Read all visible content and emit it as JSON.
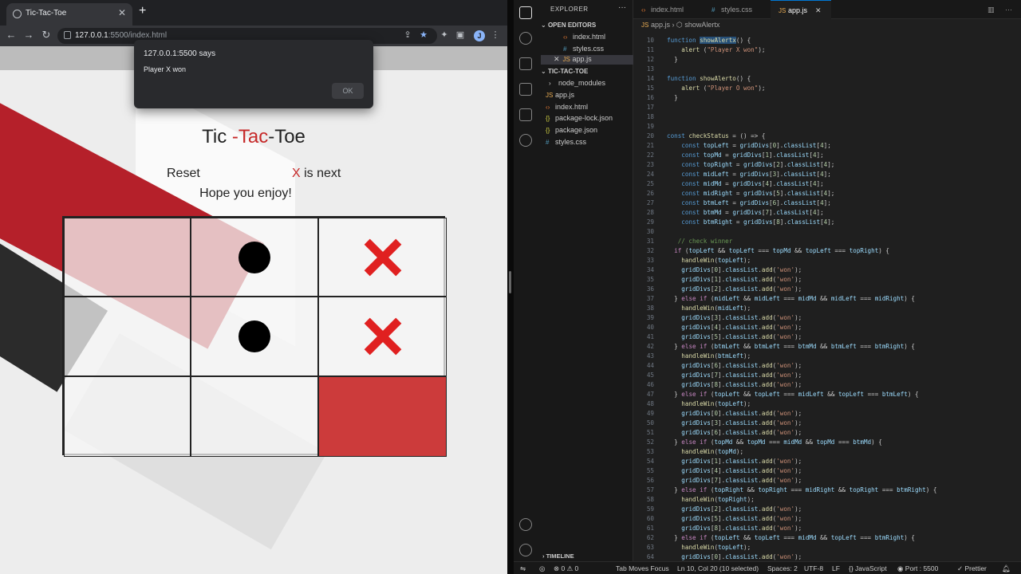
{
  "browser": {
    "tab_title": "Tic-Tac-Toe",
    "url_host": "127.0.0.1",
    "url_rest": ":5500/index.html",
    "profile_initial": "J"
  },
  "alert": {
    "origin": "127.0.0.1:5500 says",
    "message": "Player X won",
    "ok_label": "OK"
  },
  "game": {
    "title_part1": "Tic ",
    "title_part2": "-Tac",
    "title_part3": "-Toe",
    "reset_label": "Reset",
    "status_mark": "X",
    "status_text": " is next",
    "greeting": "Hope you enjoy!",
    "cells": [
      "",
      "o",
      "x",
      "",
      "o",
      "x",
      "",
      "",
      "won"
    ]
  },
  "vscode": {
    "explorer_title": "EXPLORER",
    "open_editors": "OPEN EDITORS",
    "open_files": [
      "index.html",
      "styles.css",
      "app.js"
    ],
    "project": "TIC-TAC-TOE",
    "project_files": [
      "node_modules",
      "app.js",
      "index.html",
      "package-lock.json",
      "package.json",
      "styles.css"
    ],
    "tabs": [
      "index.html",
      "styles.css",
      "app.js"
    ],
    "breadcrumb_file": "app.js",
    "breadcrumb_symbol": "showAlertx",
    "timeline": "TIMELINE",
    "status": {
      "problems": "⊗ 0 ⚠ 0",
      "tab_moves": "Tab Moves Focus",
      "position": "Ln 10, Col 20 (10 selected)",
      "spaces": "Spaces: 2",
      "encoding": "UTF-8",
      "eol": "LF",
      "language": "{} JavaScript",
      "port": "◉ Port : 5500",
      "prettier": "✓ Prettier"
    }
  },
  "code_lines": [
    {
      "n": "10",
      "t": "function showAlertx() {"
    },
    {
      "n": "11",
      "t": "    alert (\"Player X won\");"
    },
    {
      "n": "12",
      "t": "  }"
    },
    {
      "n": "13",
      "t": ""
    },
    {
      "n": "14",
      "t": "function showAlerto() {"
    },
    {
      "n": "15",
      "t": "    alert (\"Player O won\");"
    },
    {
      "n": "16",
      "t": "  }"
    },
    {
      "n": "17",
      "t": ""
    },
    {
      "n": "18",
      "t": ""
    },
    {
      "n": "19",
      "t": ""
    },
    {
      "n": "20",
      "t": "const checkStatus = () => {"
    },
    {
      "n": "21",
      "t": "    const topLeft = gridDivs[0].classList[4];"
    },
    {
      "n": "22",
      "t": "    const topMd = gridDivs[1].classList[4];"
    },
    {
      "n": "23",
      "t": "    const topRight = gridDivs[2].classList[4];"
    },
    {
      "n": "24",
      "t": "    const midLeft = gridDivs[3].classList[4];"
    },
    {
      "n": "25",
      "t": "    const midMd = gridDivs[4].classList[4];"
    },
    {
      "n": "26",
      "t": "    const midRight = gridDivs[5].classList[4];"
    },
    {
      "n": "27",
      "t": "    const btmLeft = gridDivs[6].classList[4];"
    },
    {
      "n": "28",
      "t": "    const btmMd = gridDivs[7].classList[4];"
    },
    {
      "n": "29",
      "t": "    const btmRight = gridDivs[8].classList[4];"
    },
    {
      "n": "30",
      "t": ""
    },
    {
      "n": "31",
      "t": "   // check winner"
    },
    {
      "n": "32",
      "t": "  if (topLeft && topLeft === topMd && topLeft === topRight) {"
    },
    {
      "n": "33",
      "t": "    handleWin(topLeft);"
    },
    {
      "n": "34",
      "t": "    gridDivs[0].classList.add('won');"
    },
    {
      "n": "35",
      "t": "    gridDivs[1].classList.add('won');"
    },
    {
      "n": "36",
      "t": "    gridDivs[2].classList.add('won');"
    },
    {
      "n": "37",
      "t": "  } else if (midLeft && midLeft === midMd && midLeft === midRight) {"
    },
    {
      "n": "38",
      "t": "    handleWin(midLeft);"
    },
    {
      "n": "39",
      "t": "    gridDivs[3].classList.add('won');"
    },
    {
      "n": "40",
      "t": "    gridDivs[4].classList.add('won');"
    },
    {
      "n": "41",
      "t": "    gridDivs[5].classList.add('won');"
    },
    {
      "n": "42",
      "t": "  } else if (btmLeft && btmLeft === btmMd && btmLeft === btmRight) {"
    },
    {
      "n": "43",
      "t": "    handleWin(btmLeft);"
    },
    {
      "n": "44",
      "t": "    gridDivs[6].classList.add('won');"
    },
    {
      "n": "45",
      "t": "    gridDivs[7].classList.add('won');"
    },
    {
      "n": "46",
      "t": "    gridDivs[8].classList.add('won');"
    },
    {
      "n": "47",
      "t": "  } else if (topLeft && topLeft === midLeft && topLeft === btmLeft) {"
    },
    {
      "n": "48",
      "t": "    handleWin(topLeft);"
    },
    {
      "n": "49",
      "t": "    gridDivs[0].classList.add('won');"
    },
    {
      "n": "50",
      "t": "    gridDivs[3].classList.add('won');"
    },
    {
      "n": "51",
      "t": "    gridDivs[6].classList.add('won');"
    },
    {
      "n": "52",
      "t": "  } else if (topMd && topMd === midMd && topMd === btmMd) {"
    },
    {
      "n": "53",
      "t": "    handleWin(topMd);"
    },
    {
      "n": "54",
      "t": "    gridDivs[1].classList.add('won');"
    },
    {
      "n": "55",
      "t": "    gridDivs[4].classList.add('won');"
    },
    {
      "n": "56",
      "t": "    gridDivs[7].classList.add('won');"
    },
    {
      "n": "57",
      "t": "  } else if (topRight && topRight === midRight && topRight === btmRight) {"
    },
    {
      "n": "58",
      "t": "    handleWin(topRight);"
    },
    {
      "n": "59",
      "t": "    gridDivs[2].classList.add('won');"
    },
    {
      "n": "60",
      "t": "    gridDivs[5].classList.add('won');"
    },
    {
      "n": "61",
      "t": "    gridDivs[8].classList.add('won');"
    },
    {
      "n": "62",
      "t": "  } else if (topLeft && topLeft === midMd && topLeft === btmRight) {"
    },
    {
      "n": "63",
      "t": "    handleWin(topLeft);"
    },
    {
      "n": "64",
      "t": "    gridDivs[0].classList.add('won');"
    }
  ]
}
